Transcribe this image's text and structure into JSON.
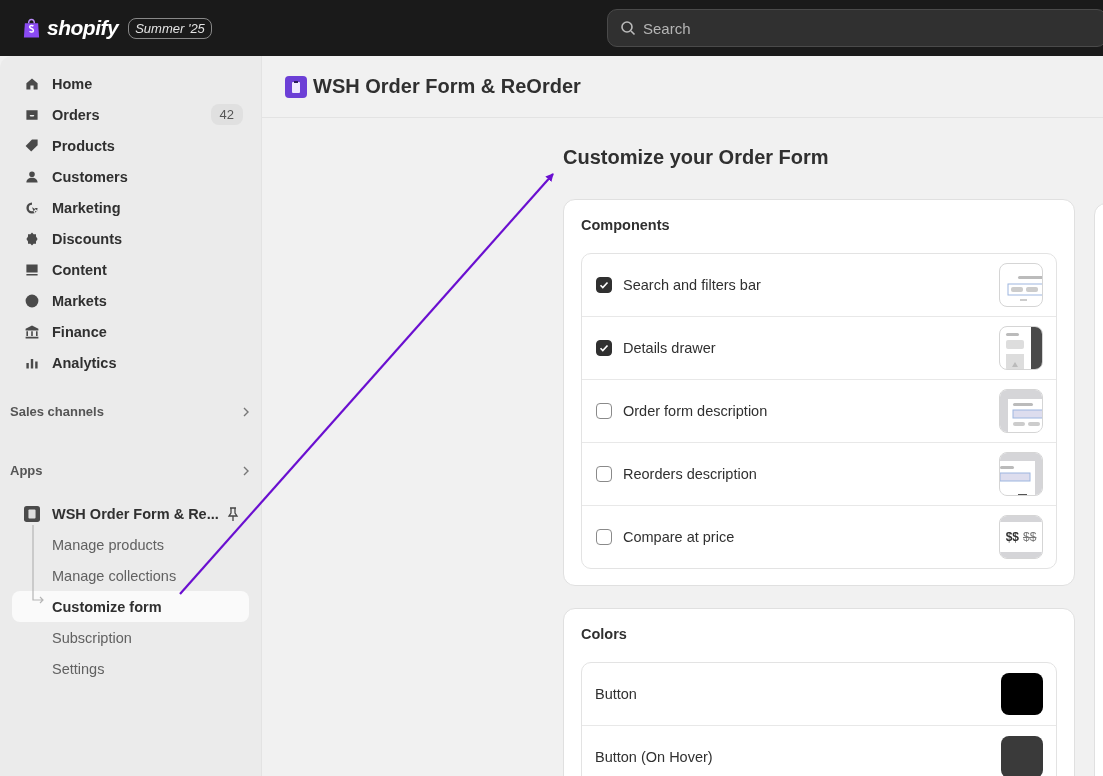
{
  "topbar": {
    "brand": "shopify",
    "badge": "Summer '25",
    "search": {
      "placeholder": "Search"
    }
  },
  "sidebar": {
    "items": [
      {
        "label": "Home"
      },
      {
        "label": "Orders",
        "count": "42"
      },
      {
        "label": "Products"
      },
      {
        "label": "Customers"
      },
      {
        "label": "Marketing"
      },
      {
        "label": "Discounts"
      },
      {
        "label": "Content"
      },
      {
        "label": "Markets"
      },
      {
        "label": "Finance"
      },
      {
        "label": "Analytics"
      }
    ],
    "sections": [
      {
        "label": "Sales channels"
      },
      {
        "label": "Apps"
      }
    ],
    "app": {
      "label": "WSH Order Form & Re...",
      "children": [
        {
          "label": "Manage products",
          "selected": false
        },
        {
          "label": "Manage collections",
          "selected": false
        },
        {
          "label": "Customize form",
          "selected": true
        },
        {
          "label": "Subscription",
          "selected": false
        },
        {
          "label": "Settings",
          "selected": false
        }
      ]
    }
  },
  "header": {
    "title": "WSH Order Form & ReOrder"
  },
  "page": {
    "title": "Customize your Order Form"
  },
  "components": {
    "title": "Components",
    "items": [
      {
        "label": "Search and filters bar",
        "checked": true,
        "kind": "search"
      },
      {
        "label": "Details drawer",
        "checked": true,
        "kind": "drawer"
      },
      {
        "label": "Order form description",
        "checked": false,
        "kind": "description"
      },
      {
        "label": "Reorders description",
        "checked": false,
        "kind": "reorders"
      },
      {
        "label": "Compare at price",
        "checked": false,
        "kind": "price",
        "price": "$$",
        "compare_price": "$$"
      }
    ]
  },
  "colors": {
    "title": "Colors",
    "items": [
      {
        "label": "Button",
        "color": "#000000"
      },
      {
        "label": "Button (On Hover)",
        "color": "#3a3a3a"
      }
    ]
  }
}
